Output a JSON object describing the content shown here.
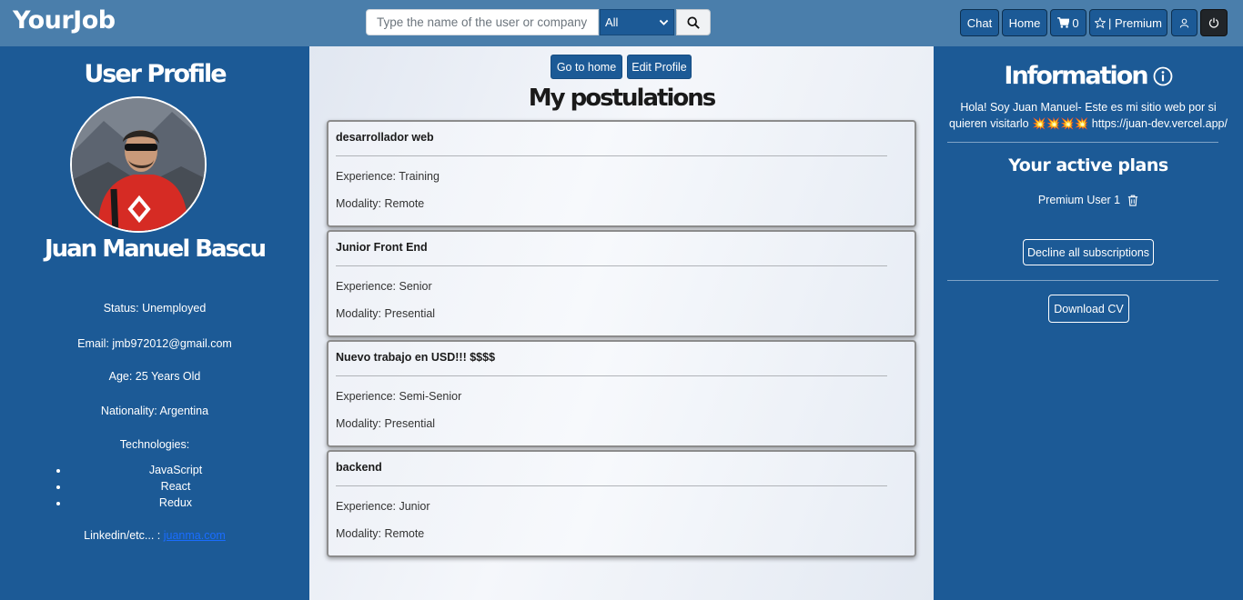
{
  "navbar": {
    "brand": "YourJob",
    "search_placeholder": "Type the name of the user or company",
    "search_filter": "All",
    "chat_label": "Chat",
    "home_label": "Home",
    "cart_count": "0",
    "premium_label": "| Premium"
  },
  "profile": {
    "title": "User Profile",
    "name": "Juan Manuel Bascu",
    "status": "Status: Unemployed",
    "email": "Email: jmb972012@gmail.com",
    "age": "Age: 25 Years Old",
    "nationality": "Nationality: Argentina",
    "technologies_label": "Technologies:",
    "technologies": [
      "JavaScript",
      "React",
      "Redux"
    ],
    "linkedin_label": "Linkedin/etc... :",
    "linkedin_link": "juanma.com"
  },
  "main": {
    "go_home_label": "Go to home",
    "edit_profile_label": "Edit Profile",
    "title": "My postulations",
    "postulations": [
      {
        "title": "desarrollador web",
        "experience": "Experience: Training",
        "modality": "Modality: Remote"
      },
      {
        "title": "Junior Front End",
        "experience": "Experience: Senior",
        "modality": "Modality: Presential"
      },
      {
        "title": "Nuevo trabajo en USD!!! $$$$",
        "experience": "Experience: Semi-Senior",
        "modality": "Modality: Presential"
      },
      {
        "title": "backend",
        "experience": "Experience: Junior",
        "modality": "Modality: Remote"
      }
    ]
  },
  "info": {
    "title": "Information",
    "description": "Hola! Soy Juan Manuel- Este es mi sitio web por si quieren visitarlo 💥💥💥💥 https://juan-dev.vercel.app/",
    "plans_title": "Your active plans",
    "plan_name": "Premium User 1",
    "decline_label": "Decline all subscriptions",
    "download_cv_label": "Download CV"
  },
  "colors": {
    "navbar": "#4a7eab",
    "panel": "#1c5a96",
    "button": "#1c5a96",
    "link": "#1a6dff"
  },
  "icons": [
    "search-icon",
    "chevron-down-icon",
    "cart-icon",
    "star-icon",
    "user-icon",
    "power-icon",
    "info-circle-icon",
    "trash-icon"
  ]
}
